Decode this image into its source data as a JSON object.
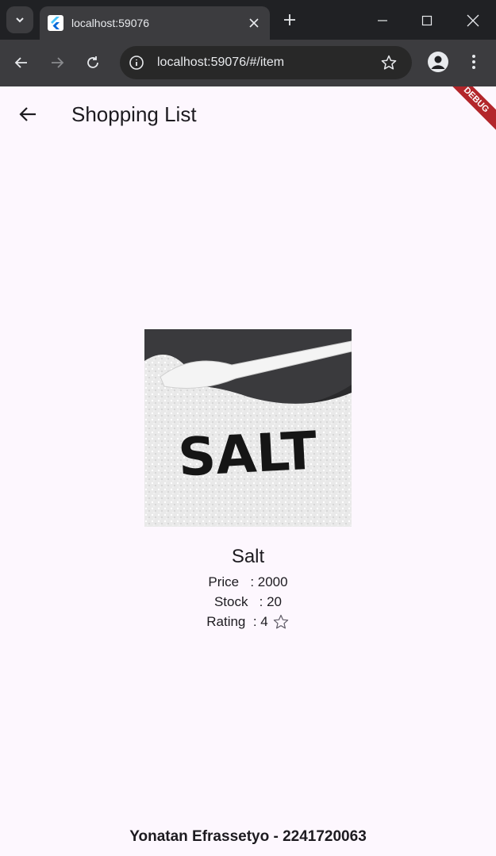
{
  "browser": {
    "tab_title": "localhost:59076",
    "url": "localhost:59076/#/item"
  },
  "app": {
    "title": "Shopping List",
    "debug_label": "DEBUG"
  },
  "product": {
    "image_text": "SALT",
    "name": "Salt",
    "price_label": "Price   ",
    "price_value": ": 2000",
    "stock_label": "Stock   ",
    "stock_value": ": 20",
    "rating_label": "Rating  ",
    "rating_value": ": 4"
  },
  "footer": {
    "text": "Yonatan Efrassetyo - 2241720063"
  },
  "colors": {
    "page_bg": "#fdf7fe",
    "chrome_dark": "#202124",
    "chrome_tab": "#3c3c3f",
    "debug_red": "#b3262b"
  }
}
